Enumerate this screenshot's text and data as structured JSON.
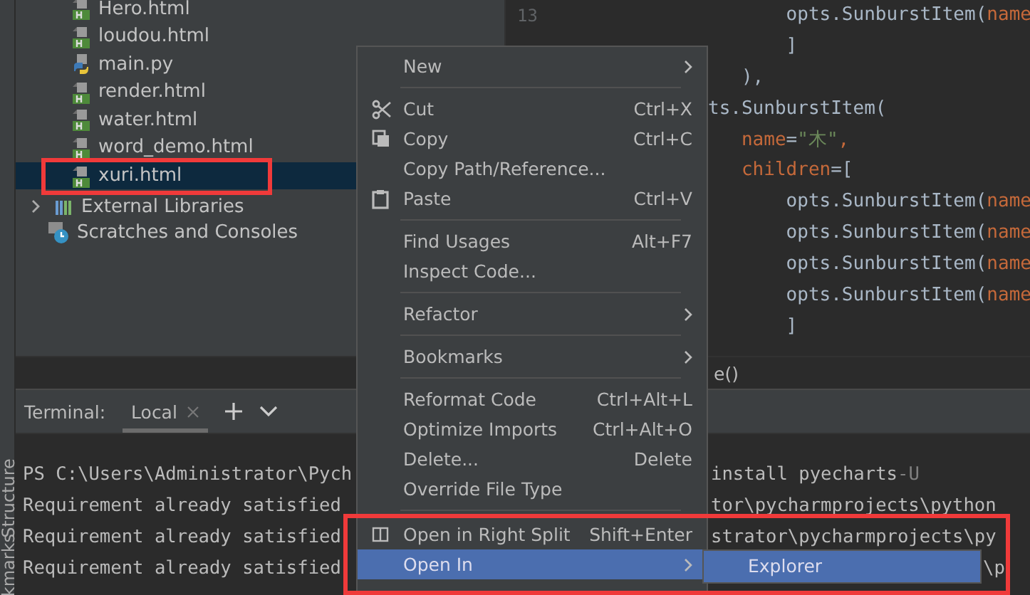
{
  "project_tree": {
    "items": [
      {
        "label": "Hero.html",
        "kind": "html",
        "selected": false
      },
      {
        "label": "loudou.html",
        "kind": "html",
        "selected": false
      },
      {
        "label": "main.py",
        "kind": "python",
        "selected": false
      },
      {
        "label": "render.html",
        "kind": "html",
        "selected": false
      },
      {
        "label": "water.html",
        "kind": "html",
        "selected": false
      },
      {
        "label": "word_demo.html",
        "kind": "html",
        "selected": false
      },
      {
        "label": "xuri.html",
        "kind": "html",
        "selected": true
      },
      {
        "label": "External Libraries",
        "kind": "library",
        "selected": false
      },
      {
        "label": "Scratches and Consoles",
        "kind": "scratches",
        "selected": false
      }
    ]
  },
  "editor": {
    "line_numbers": [
      "13"
    ],
    "code_lines": [
      [
        {
          "t": "       opts.SunburstItem(",
          "kind": "plain"
        },
        {
          "t": "name",
          "kind": "param"
        }
      ],
      [
        {
          "t": "       ]",
          "kind": "plain"
        }
      ],
      [
        {
          "t": "   ),",
          "kind": "plain"
        }
      ],
      [
        {
          "t": "ts.SunburstItem(",
          "kind": "plain"
        }
      ],
      [
        {
          "t": "   name",
          "kind": "param"
        },
        {
          "t": "=",
          "kind": "plain"
        },
        {
          "t": "\"木\"",
          "kind": "string"
        },
        {
          "t": ",",
          "kind": "param"
        }
      ],
      [
        {
          "t": "   children",
          "kind": "param"
        },
        {
          "t": "=[",
          "kind": "plain"
        }
      ],
      [
        {
          "t": "       opts.SunburstItem(",
          "kind": "plain"
        },
        {
          "t": "name",
          "kind": "param"
        }
      ],
      [
        {
          "t": "       opts.SunburstItem(",
          "kind": "plain"
        },
        {
          "t": "name",
          "kind": "param"
        }
      ],
      [
        {
          "t": "       opts.SunburstItem(",
          "kind": "plain"
        },
        {
          "t": "name",
          "kind": "param"
        }
      ],
      [
        {
          "t": "       opts.SunburstItem(",
          "kind": "plain"
        },
        {
          "t": "name",
          "kind": "param"
        }
      ],
      [
        {
          "t": "       ]",
          "kind": "plain"
        }
      ]
    ],
    "breadcrumb": "e()"
  },
  "side_strip": {
    "labels": [
      "Structure",
      "kmarks"
    ]
  },
  "terminal": {
    "title": "Terminal:",
    "tabs": [
      {
        "label": "Local",
        "selected": true
      }
    ],
    "lines": [
      {
        "left": "PS C:\\Users\\Administrator\\Pych",
        "right": "install pyecharts",
        "flag": "-U"
      },
      {
        "left": "Requirement already satisfied",
        "right": "tor\\pycharmprojects\\python"
      },
      {
        "left": "Requirement already satisfied",
        "right": "strator\\pycharmprojects\\py"
      },
      {
        "left": "Requirement already satisfied",
        "right": "\\p"
      }
    ]
  },
  "context_menu": {
    "groups": [
      [
        {
          "label": "New",
          "kind": "plain",
          "submenu": true,
          "selected": false
        }
      ],
      [
        {
          "label": "Cut",
          "kind": "cut",
          "shortcut": "Ctrl+X",
          "submenu": false,
          "selected": false
        },
        {
          "label": "Copy",
          "kind": "copy",
          "shortcut": "Ctrl+C",
          "submenu": false,
          "selected": false
        },
        {
          "label": "Copy Path/Reference...",
          "kind": "plain",
          "submenu": false,
          "selected": false
        },
        {
          "label": "Paste",
          "kind": "paste",
          "shortcut": "Ctrl+V",
          "submenu": false,
          "selected": false
        }
      ],
      [
        {
          "label": "Find Usages",
          "kind": "plain",
          "shortcut": "Alt+F7",
          "submenu": false,
          "selected": false
        },
        {
          "label": "Inspect Code...",
          "kind": "plain",
          "submenu": false,
          "selected": false
        }
      ],
      [
        {
          "label": "Refactor",
          "kind": "plain",
          "submenu": true,
          "selected": false
        }
      ],
      [
        {
          "label": "Bookmarks",
          "kind": "plain",
          "submenu": true,
          "selected": false
        }
      ],
      [
        {
          "label": "Reformat Code",
          "kind": "plain",
          "shortcut": "Ctrl+Alt+L",
          "submenu": false,
          "selected": false
        },
        {
          "label": "Optimize Imports",
          "kind": "plain",
          "shortcut": "Ctrl+Alt+O",
          "submenu": false,
          "selected": false
        },
        {
          "label": "Delete...",
          "kind": "plain",
          "shortcut": "Delete",
          "submenu": false,
          "selected": false
        },
        {
          "label": "Override File Type",
          "kind": "plain",
          "submenu": false,
          "selected": false
        }
      ],
      [
        {
          "label": "Open in Right Split",
          "kind": "split",
          "shortcut": "Shift+Enter",
          "submenu": false,
          "selected": false
        },
        {
          "label": "Open In",
          "kind": "plain",
          "submenu": true,
          "selected": true
        }
      ]
    ]
  },
  "submenu": {
    "items": [
      {
        "label": "Explorer",
        "selected": true
      }
    ]
  }
}
